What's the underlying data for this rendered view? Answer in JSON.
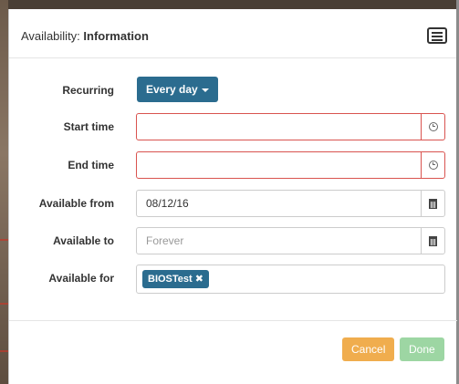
{
  "dialog": {
    "title_prefix": "Availability: ",
    "title_strong": "Information"
  },
  "form": {
    "recurring": {
      "label": "Recurring",
      "value": "Every day"
    },
    "start_time": {
      "label": "Start time",
      "value": "",
      "placeholder": ""
    },
    "end_time": {
      "label": "End time",
      "value": "",
      "placeholder": ""
    },
    "available_from": {
      "label": "Available from",
      "value": "08/12/16"
    },
    "available_to": {
      "label": "Available to",
      "value": "",
      "placeholder": "Forever"
    },
    "available_for": {
      "label": "Available for",
      "tags": [
        "BIOSTest"
      ]
    }
  },
  "footer": {
    "cancel_label": "Cancel",
    "done_label": "Done"
  },
  "colors": {
    "primary": "#2b6c8f",
    "error_border": "#d9534f",
    "cancel": "#f0ad4e",
    "done_disabled": "#9dd6a3"
  },
  "icons": {
    "menu": "list-menu-icon",
    "clock": "clock-icon",
    "calendar": "calendar-icon",
    "remove": "close-icon"
  }
}
